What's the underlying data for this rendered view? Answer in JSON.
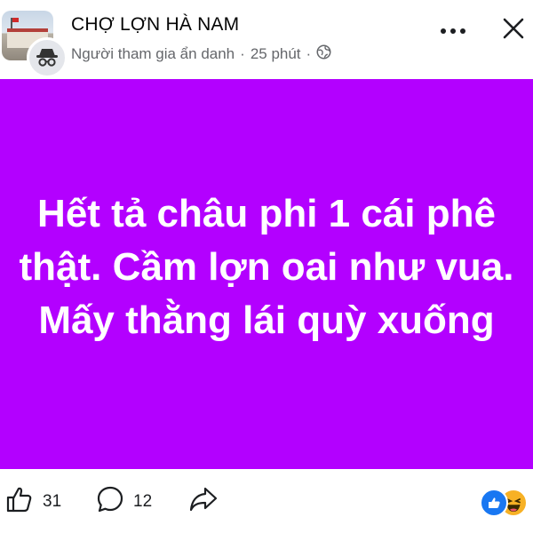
{
  "header": {
    "group_name": "CHỢ LỢN HÀ NAM",
    "author": "Người tham gia ẩn danh",
    "time": "25 phút",
    "separator": "·"
  },
  "post": {
    "text": "Hết tả châu phi 1 cái phê thật. Cầm lợn oai như vua. Mấy thằng lái quỳ xuống",
    "background_color": "#b300ff"
  },
  "actions": {
    "like_count": "31",
    "comment_count": "12"
  },
  "icons": {
    "more": "more-dots-icon",
    "close": "close-icon",
    "privacy": "globe-icon",
    "like": "thumbs-up-icon",
    "comment": "comment-bubble-icon",
    "share": "share-arrow-icon",
    "reaction_like": "like-reaction-icon",
    "reaction_haha": "haha-reaction-icon"
  }
}
